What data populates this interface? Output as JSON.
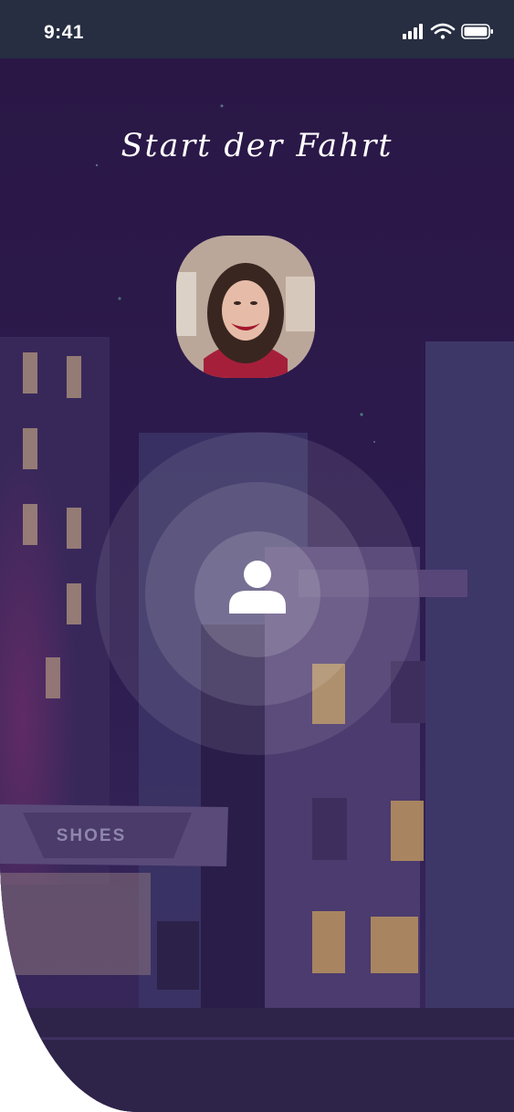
{
  "status_bar": {
    "time": "9:41",
    "icons": [
      "signal-icon",
      "wifi-icon",
      "battery-icon"
    ]
  },
  "header": {
    "title": "Start der Fahrt"
  },
  "driver": {
    "avatar": "driver-avatar-photo"
  },
  "call": {
    "icon": "person-icon"
  },
  "background": {
    "sign_text": "SHOES"
  },
  "colors": {
    "status_bar": "#272e41",
    "background": "#2c1747",
    "text": "#ffffff"
  }
}
